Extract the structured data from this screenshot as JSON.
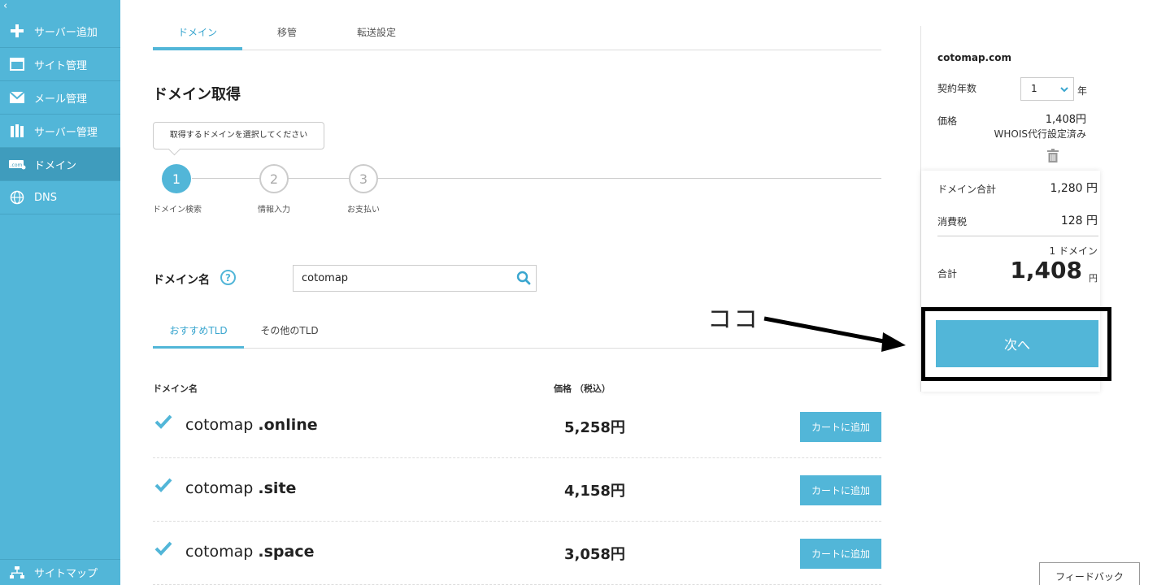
{
  "sidebar": {
    "collapse": "‹",
    "items": [
      {
        "label": "サーバー追加",
        "icon": "plus-icon"
      },
      {
        "label": "サイト管理",
        "icon": "window-icon"
      },
      {
        "label": "メール管理",
        "icon": "mail-icon"
      },
      {
        "label": "サーバー管理",
        "icon": "server-icon"
      },
      {
        "label": "ドメイン",
        "icon": "dotcom-icon",
        "active": true
      },
      {
        "label": "DNS",
        "icon": "globe-icon"
      }
    ],
    "bottom": {
      "label": "サイトマップ",
      "icon": "sitemap-icon"
    }
  },
  "tabs": [
    {
      "label": "ドメイン",
      "active": true
    },
    {
      "label": "移管"
    },
    {
      "label": "転送設定"
    }
  ],
  "page_title": "ドメイン取得",
  "tooltip": "取得するドメインを選択してください",
  "steps": [
    {
      "num": "1",
      "label": "ドメイン検索",
      "active": true
    },
    {
      "num": "2",
      "label": "情報入力"
    },
    {
      "num": "3",
      "label": "お支払い"
    }
  ],
  "search": {
    "label": "ドメイン名",
    "help": "?",
    "value": "cotomap"
  },
  "subtabs": [
    {
      "label": "おすすめTLD",
      "active": true
    },
    {
      "label": "その他のTLD"
    }
  ],
  "table": {
    "col_domain": "ドメイン名",
    "col_price": "価格 （税込）",
    "rows": [
      {
        "name": "cotomap",
        "tld": ".online",
        "price": "5,258円",
        "button": "カートに追加"
      },
      {
        "name": "cotomap",
        "tld": ".site",
        "price": "4,158円",
        "button": "カートに追加"
      },
      {
        "name": "cotomap",
        "tld": ".space",
        "price": "3,058円",
        "button": "カートに追加"
      }
    ]
  },
  "cart": {
    "domain": "cotomap.com",
    "years_label": "契約年数",
    "years_value": "1",
    "years_unit": "年",
    "price_label": "価格",
    "price_value": "1,408円",
    "whois_note": "WHOIS代行設定済み",
    "subtotal_label": "ドメイン合計",
    "subtotal_value": "1,280 円",
    "tax_label": "消費税",
    "tax_value": "128 円",
    "count": "1 ドメイン",
    "total_label": "合計",
    "total_value": "1,408",
    "total_unit": "円",
    "next_button": "次へ"
  },
  "annotation": {
    "text": "ココ"
  },
  "feedback": "フィードバック",
  "colors": {
    "accent": "#52b6d8",
    "sidebar_active": "#3f9cbd"
  }
}
